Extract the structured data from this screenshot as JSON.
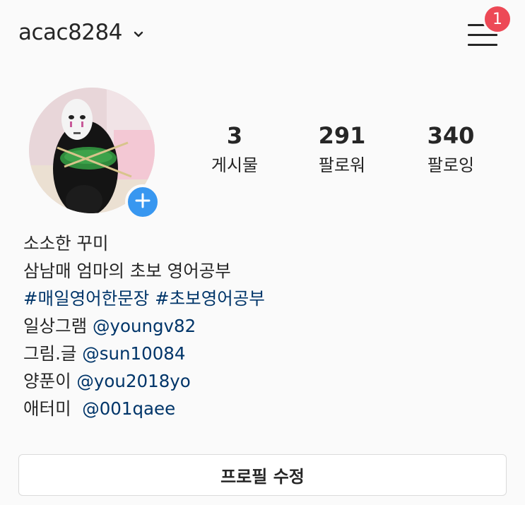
{
  "header": {
    "username": "acac8284",
    "notification_count": "1"
  },
  "profile": {
    "stats": [
      {
        "value": "3",
        "label": "게시물"
      },
      {
        "value": "291",
        "label": "팔로워"
      },
      {
        "value": "340",
        "label": "팔로잉"
      }
    ]
  },
  "bio": {
    "name": "소소한 꾸미",
    "line1": "삼남매 엄마의 초보 영어공부",
    "hashtag1": "#매일영어한문장",
    "hashtag2": "#초보영어공부",
    "links": [
      {
        "prefix": "일상그램 ",
        "handle": "@youngv82"
      },
      {
        "prefix": "그림.글 ",
        "handle": "@sun10084"
      },
      {
        "prefix": "양푼이 ",
        "handle": "@you2018yo"
      },
      {
        "prefix": "애터미  ",
        "handle": "@001qaee"
      }
    ]
  },
  "actions": {
    "edit_profile_label": "프로필 수정"
  },
  "colors": {
    "accent": "#3897f0",
    "badge": "#ed4956",
    "link": "#003569",
    "text": "#262626",
    "background": "#fafafa"
  },
  "icons": [
    "chevron-down-icon",
    "menu-icon",
    "plus-icon"
  ]
}
